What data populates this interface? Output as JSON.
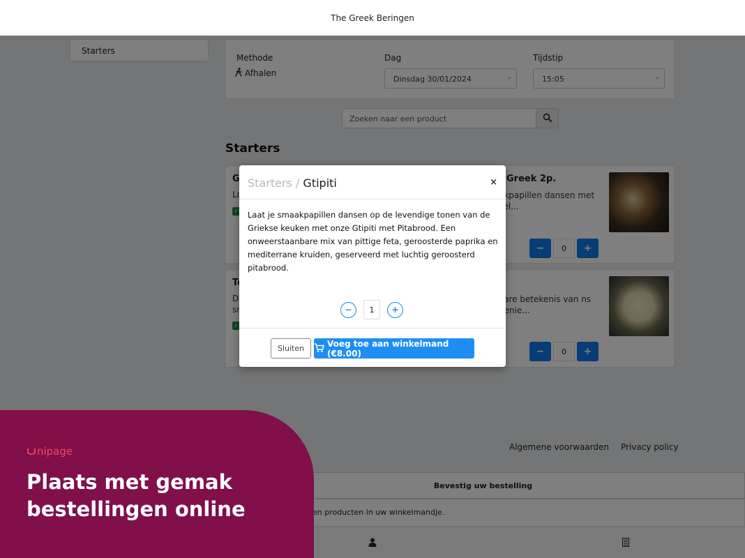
{
  "header": {
    "title": "The Greek Beringen"
  },
  "sidebar": {
    "items": [
      {
        "label": "Starters"
      }
    ]
  },
  "filters": {
    "method_label": "Methode",
    "method_value": "Afhalen",
    "day_label": "Dag",
    "day_value": "Dinsdag 30/01/2024",
    "time_label": "Tijdstip",
    "time_value": "15:05"
  },
  "search": {
    "placeholder": "Zoeken naar een product"
  },
  "section": {
    "title": "Starters"
  },
  "products": [
    {
      "name_partial": "G",
      "name_right": "Greek 2p.",
      "desc_partial": "Lo",
      "desc_right": "akpapillen dansen met kel...",
      "qty": "0"
    },
    {
      "name_partial": "To",
      "desc_partial": "De",
      "desc_partial2": "sm",
      "desc_right": "vare betekenis van ns genie...",
      "qty": "0"
    }
  ],
  "footer": {
    "terms": "Algemene voorwaarden",
    "privacy": "Privacy policy"
  },
  "cart": {
    "confirm": "Bevestig uw bestelling",
    "message": "en producten in uw winkelmandje."
  },
  "modal": {
    "crumb": "Starters /",
    "title": "Gtipiti",
    "close": "×",
    "description": "Laat je smaakpapillen dansen op de levendige tonen van de Griekse keuken met onze Gtipiti met Pitabrood. Een onweerstaanbare mix van pittige feta, geroosterde paprika en mediterrane kruiden, geserveerd met luchtig geroosterd pitabrood.",
    "quantity": "1",
    "minus": "−",
    "plus": "+",
    "close_button": "Sluiten",
    "add_button": "Voeg toe aan winkelmand (€8.00)"
  },
  "promo": {
    "logo": "nipage",
    "headline_1": "Plaats met gemak",
    "headline_2": "bestellingen online"
  },
  "colors": {
    "accent": "#1e8ef5",
    "brand": "#800f4a",
    "logo": "#f04a5c"
  }
}
